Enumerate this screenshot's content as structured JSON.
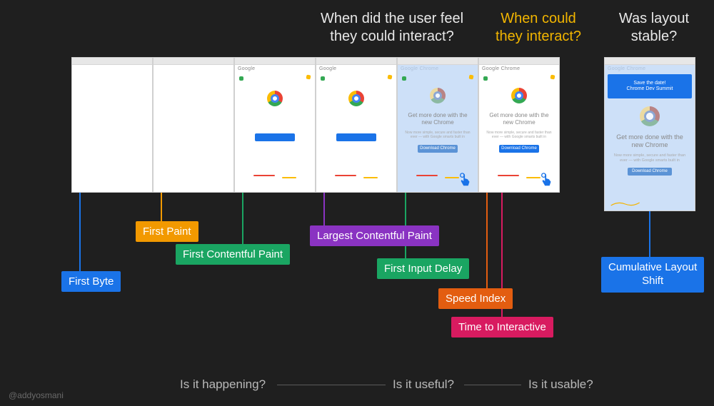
{
  "questions": {
    "feel": "When did the user feel\nthey could interact?",
    "could": "When could\nthey interact?",
    "layout": "Was layout\nstable?"
  },
  "metrics": {
    "first_byte": "First Byte",
    "first_paint": "First Paint",
    "fcp": "First Contentful Paint",
    "lcp": "Largest Contentful Paint",
    "fid": "First Input Delay",
    "speed_index": "Speed Index",
    "tti": "Time to Interactive",
    "cls": "Cumulative Layout\nShift"
  },
  "frame": {
    "title_google": "Google",
    "title_chrome": "Google Chrome",
    "banner_l1": "Save the date!",
    "banner_l2": "Chrome Dev Summit",
    "headline": "Get more done with the\nnew Chrome",
    "sub": "Now more simple, secure and faster than ever — with Google smarts built in",
    "download": "Download Chrome"
  },
  "footer": {
    "happening": "Is it happening?",
    "useful": "Is it useful?",
    "usable": "Is it usable?"
  },
  "colors": {
    "first_byte": "#1a73e8",
    "first_paint": "#f29900",
    "fcp": "#1aa562",
    "lcp": "#8a33c2",
    "fid": "#1aa562",
    "speed_index": "#e35d10",
    "tti": "#d81b60",
    "cls": "#1a73e8"
  },
  "credit": "@addyosmani"
}
